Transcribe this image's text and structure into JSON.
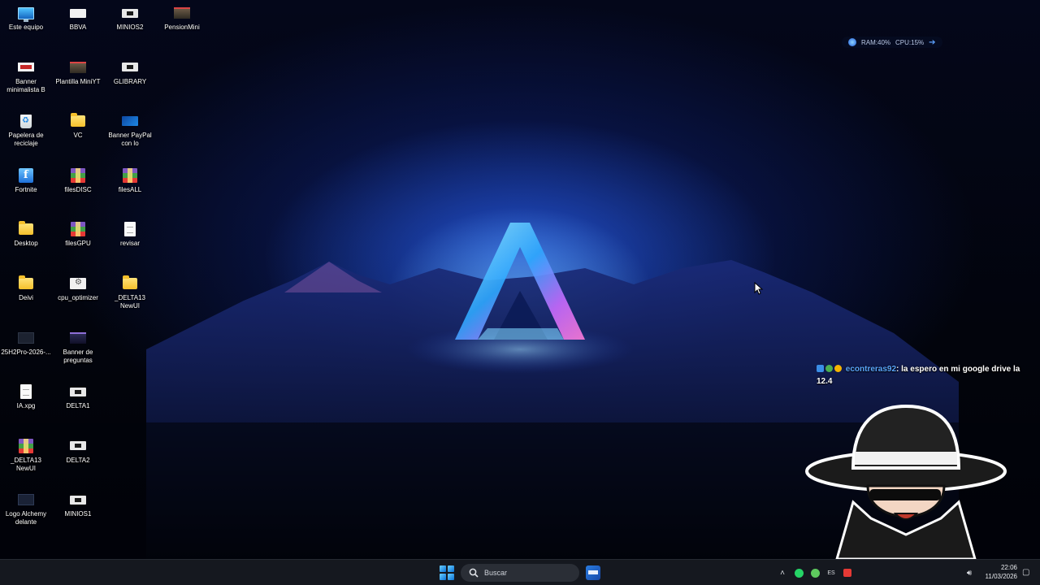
{
  "desktop": {
    "icons": [
      {
        "label": "Este equipo",
        "icon": "monitor-icon"
      },
      {
        "label": "BBVA",
        "icon": "shortcut-icon"
      },
      {
        "label": "MINIOS2",
        "icon": "shortcut-icon"
      },
      {
        "label": "PensionMini",
        "icon": "image-file-icon"
      },
      {
        "label": "Banner minimalista B",
        "icon": "image-file-icon"
      },
      {
        "label": "Plantilla MiniYT",
        "icon": "image-file-icon"
      },
      {
        "label": "GLIBRARY",
        "icon": "shortcut-icon"
      },
      {
        "label": "Papelera de reciclaje",
        "icon": "recycle-bin-icon"
      },
      {
        "label": "VC",
        "icon": "folder-icon"
      },
      {
        "label": "Banner PayPal con lo",
        "icon": "image-file-icon"
      },
      {
        "label": "Fortnite",
        "icon": "fortnite-icon"
      },
      {
        "label": "filesDISC",
        "icon": "winrar-archive-icon"
      },
      {
        "label": "filesALL",
        "icon": "winrar-archive-icon"
      },
      {
        "label": "Desktop",
        "icon": "folder-icon"
      },
      {
        "label": "filesGPU",
        "icon": "winrar-archive-icon"
      },
      {
        "label": "revisar",
        "icon": "text-document-icon"
      },
      {
        "label": "Deivi",
        "icon": "folder-icon"
      },
      {
        "label": "cpu_optimizer",
        "icon": "settings-file-icon"
      },
      {
        "label": "_DELTA13 NewUI",
        "icon": "folder-icon"
      },
      {
        "label": "25H2Pro-2026-...",
        "icon": "image-file-icon"
      },
      {
        "label": "Banner de preguntas",
        "icon": "image-file-icon"
      },
      {
        "label": "IA.xpg",
        "icon": "text-document-icon"
      },
      {
        "label": "DELTA1",
        "icon": "shortcut-icon"
      },
      {
        "label": "_DELTA13 NewUI",
        "icon": "winrar-archive-icon"
      },
      {
        "label": "DELTA2",
        "icon": "shortcut-icon"
      },
      {
        "label": "Logo Alchemy delante",
        "icon": "image-file-icon"
      },
      {
        "label": "MINIOS1",
        "icon": "shortcut-icon"
      }
    ]
  },
  "system_widget": {
    "ram": "RAM:40%",
    "cpu": "CPU:15%"
  },
  "chat": {
    "username": "econtreras92",
    "message": ": la espero en mi google drive la 12.4"
  },
  "taskbar": {
    "search_placeholder": "Buscar",
    "clock_time": "22:06",
    "clock_date": "11/03/2026"
  },
  "colors": {
    "taskbar_bg": "#15181f",
    "chat_username": "#5aa7ff",
    "accent_blue": "#1e6fd9"
  }
}
